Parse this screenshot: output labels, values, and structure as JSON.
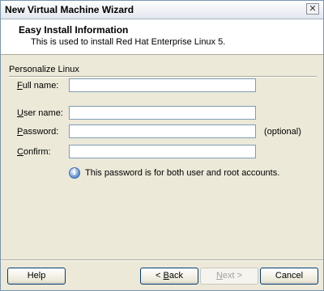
{
  "window": {
    "title": "New Virtual Machine Wizard",
    "close_glyph": "✕"
  },
  "header": {
    "title": "Easy Install Information",
    "subtitle": "This is used to install Red Hat Enterprise Linux 5."
  },
  "section": {
    "label": "Personalize Linux"
  },
  "fields": {
    "full_name": {
      "label_first": "F",
      "label_rest": "ull name:",
      "value": ""
    },
    "user_name": {
      "label_first": "U",
      "label_rest": "ser name:",
      "value": ""
    },
    "password": {
      "label_first": "P",
      "label_rest": "assword:",
      "value": "",
      "hint": "(optional)"
    },
    "confirm": {
      "label_first": "C",
      "label_rest": "onfirm:",
      "value": ""
    }
  },
  "info": {
    "icon": "info-icon",
    "text": "This password is for both user and root accounts."
  },
  "buttons": {
    "help": "Help",
    "back_prefix": "< ",
    "back_key": "B",
    "back_rest": "ack",
    "next_key": "N",
    "next_rest": "ext >",
    "cancel": "Cancel"
  },
  "colors": {
    "accent_border": "#003c74",
    "field_border": "#7f9db9",
    "background": "#ece9d8"
  }
}
